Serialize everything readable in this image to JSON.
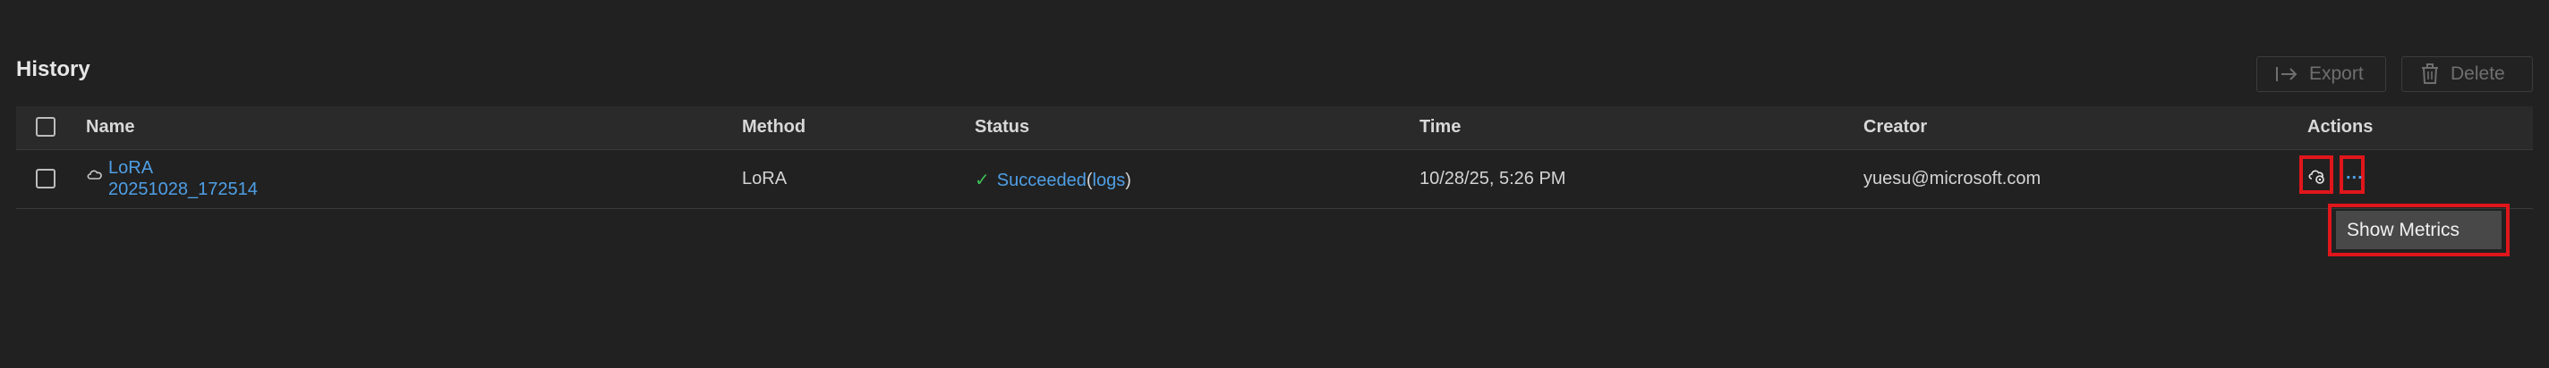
{
  "section": {
    "title": "History"
  },
  "toolbar": {
    "export_label": "Export",
    "delete_label": "Delete"
  },
  "table": {
    "columns": [
      "Name",
      "Method",
      "Status",
      "Time",
      "Creator",
      "Actions"
    ],
    "rows": [
      {
        "name_line1": "LoRA",
        "name_line2": "20251028_172514",
        "method": "LoRA",
        "status": "Succeeded",
        "logs_open": "(",
        "logs_label": "logs",
        "logs_close": ")",
        "time": "10/28/25, 5:26 PM",
        "creator": "yuesu@microsoft.com",
        "more_label": "..."
      }
    ]
  },
  "context_menu": {
    "items": [
      "Show Metrics"
    ]
  },
  "colors": {
    "background": "#212121",
    "header_bg": "#2a2a2a",
    "link": "#4f9fe6",
    "success": "#3fbf58",
    "highlight": "#e0161b",
    "menu_bg": "#484848"
  },
  "icons": {
    "export": "export-arrow-icon",
    "delete": "trash-icon",
    "name": "cloud-icon",
    "status": "checkmark-icon",
    "action_cloud": "cloud-settings-icon",
    "action_more": "more-ellipsis-icon"
  }
}
